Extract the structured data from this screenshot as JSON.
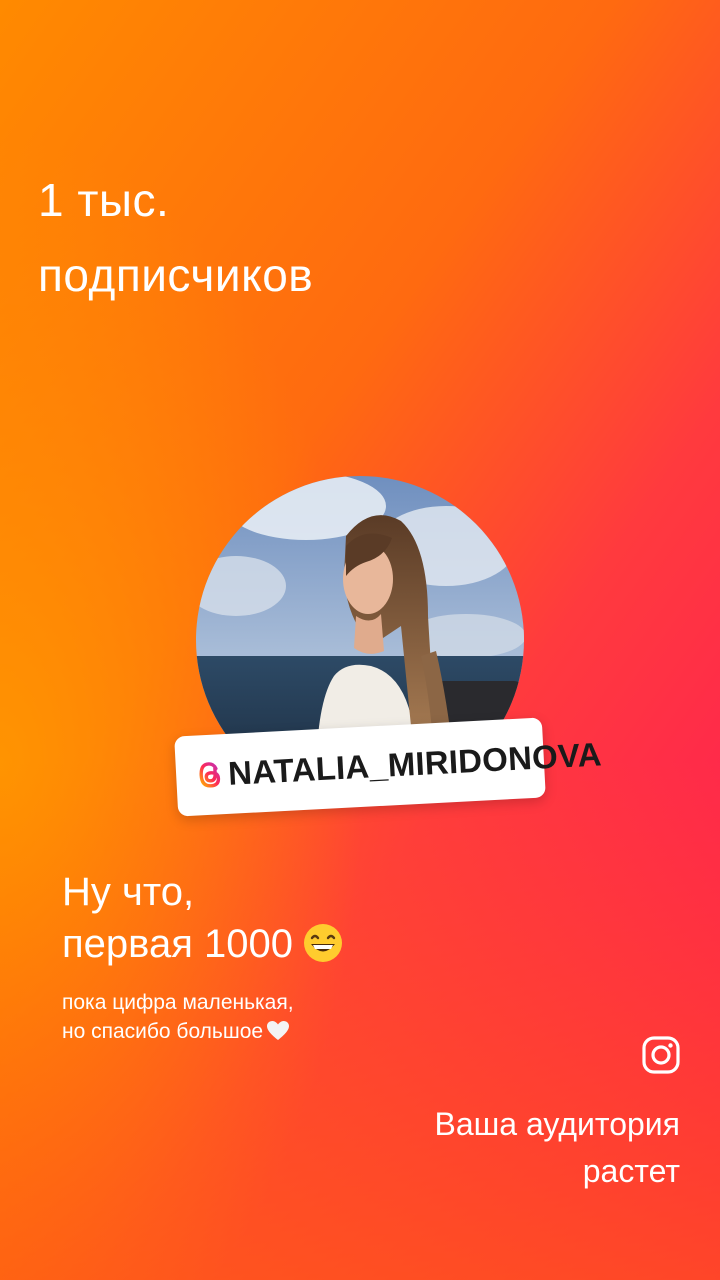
{
  "headline": {
    "line1": "1 тыс.",
    "line2": "подписчиков"
  },
  "profile": {
    "handle": "NATALIA_MIRIDONOVA",
    "handle_icon": "threads-icon",
    "avatar_alt": "profile photo"
  },
  "message": {
    "line1": "Ну что,",
    "line2": "первая 1000",
    "emoji": "grinning-face-emoji"
  },
  "subtext": {
    "line1": "пока цифра маленькая,",
    "line2": "но спасибо большое",
    "emoji": "white-heart-emoji"
  },
  "footer": {
    "icon": "instagram-icon",
    "line1": "Ваша аудитория",
    "line2": "растет"
  },
  "colors": {
    "gradient_start": "#ff8a00",
    "gradient_end": "#ff145a",
    "text": "#ffffff",
    "tag_bg": "#ffffff"
  }
}
